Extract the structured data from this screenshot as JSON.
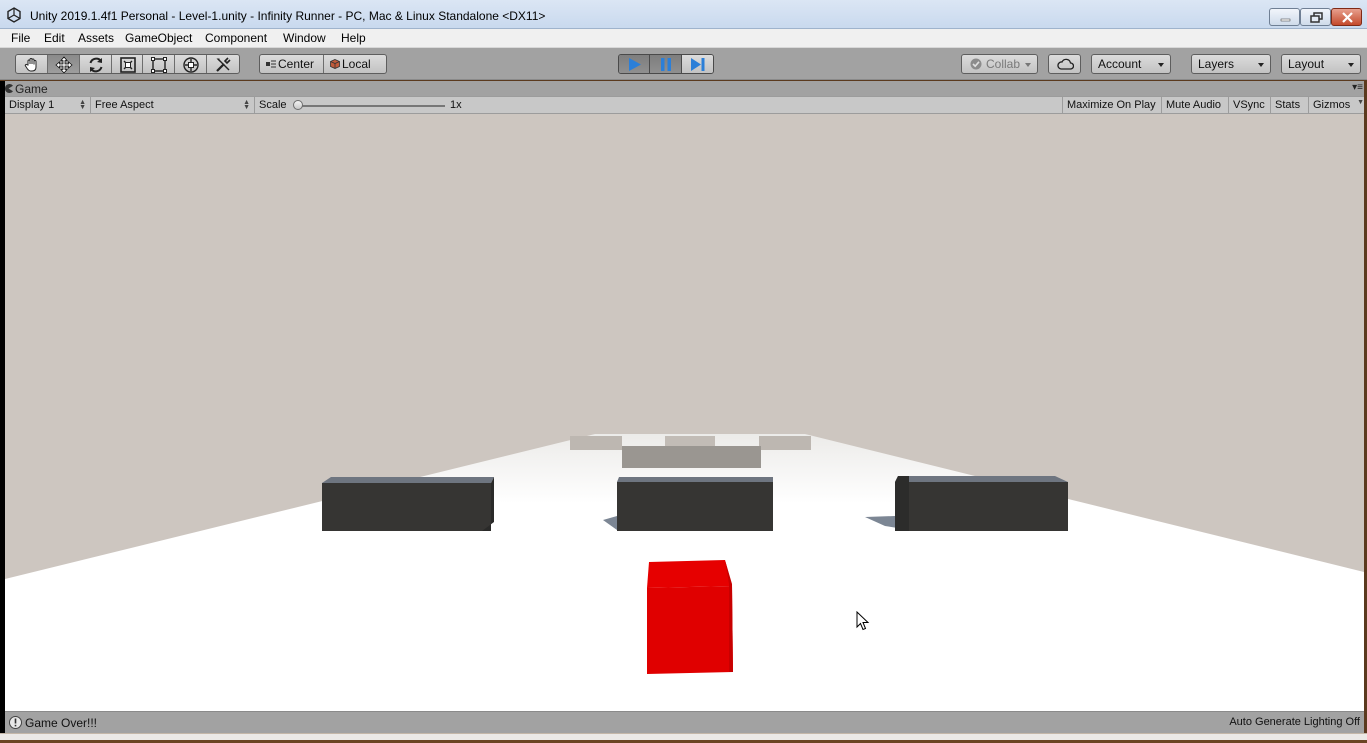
{
  "window": {
    "title": "Unity 2019.1.4f1 Personal - Level-1.unity - Infinity Runner - PC, Mac & Linux Standalone <DX11>"
  },
  "menu": {
    "items": [
      "File",
      "Edit",
      "Assets",
      "GameObject",
      "Component",
      "Window",
      "Help"
    ]
  },
  "toolbar": {
    "tools": [
      "hand-tool",
      "move-tool",
      "rotate-tool",
      "scale-tool",
      "rect-tool",
      "transform-tool",
      "custom-editor-tool"
    ],
    "active_tool": "move-tool",
    "pivot_center": "Center",
    "pivot_local": "Local",
    "collab": "Collab",
    "account": "Account",
    "layers": "Layers",
    "layout": "Layout"
  },
  "game_tab": {
    "label": "Game"
  },
  "game_bar": {
    "display": "Display 1",
    "aspect": "Free Aspect",
    "scale_label": "Scale",
    "scale_value": "1x",
    "toggles": [
      "Maximize On Play",
      "Mute Audio",
      "VSync",
      "Stats",
      "Gizmos"
    ]
  },
  "status": {
    "message": "Game Over!!!",
    "right": "Auto Generate Lighting Off"
  },
  "colors": {
    "sky": "#cdc6c0",
    "floor": "#ffffff",
    "obstacle": "#363533",
    "player": "#e00000",
    "play_blue": "#2b7fd8"
  }
}
